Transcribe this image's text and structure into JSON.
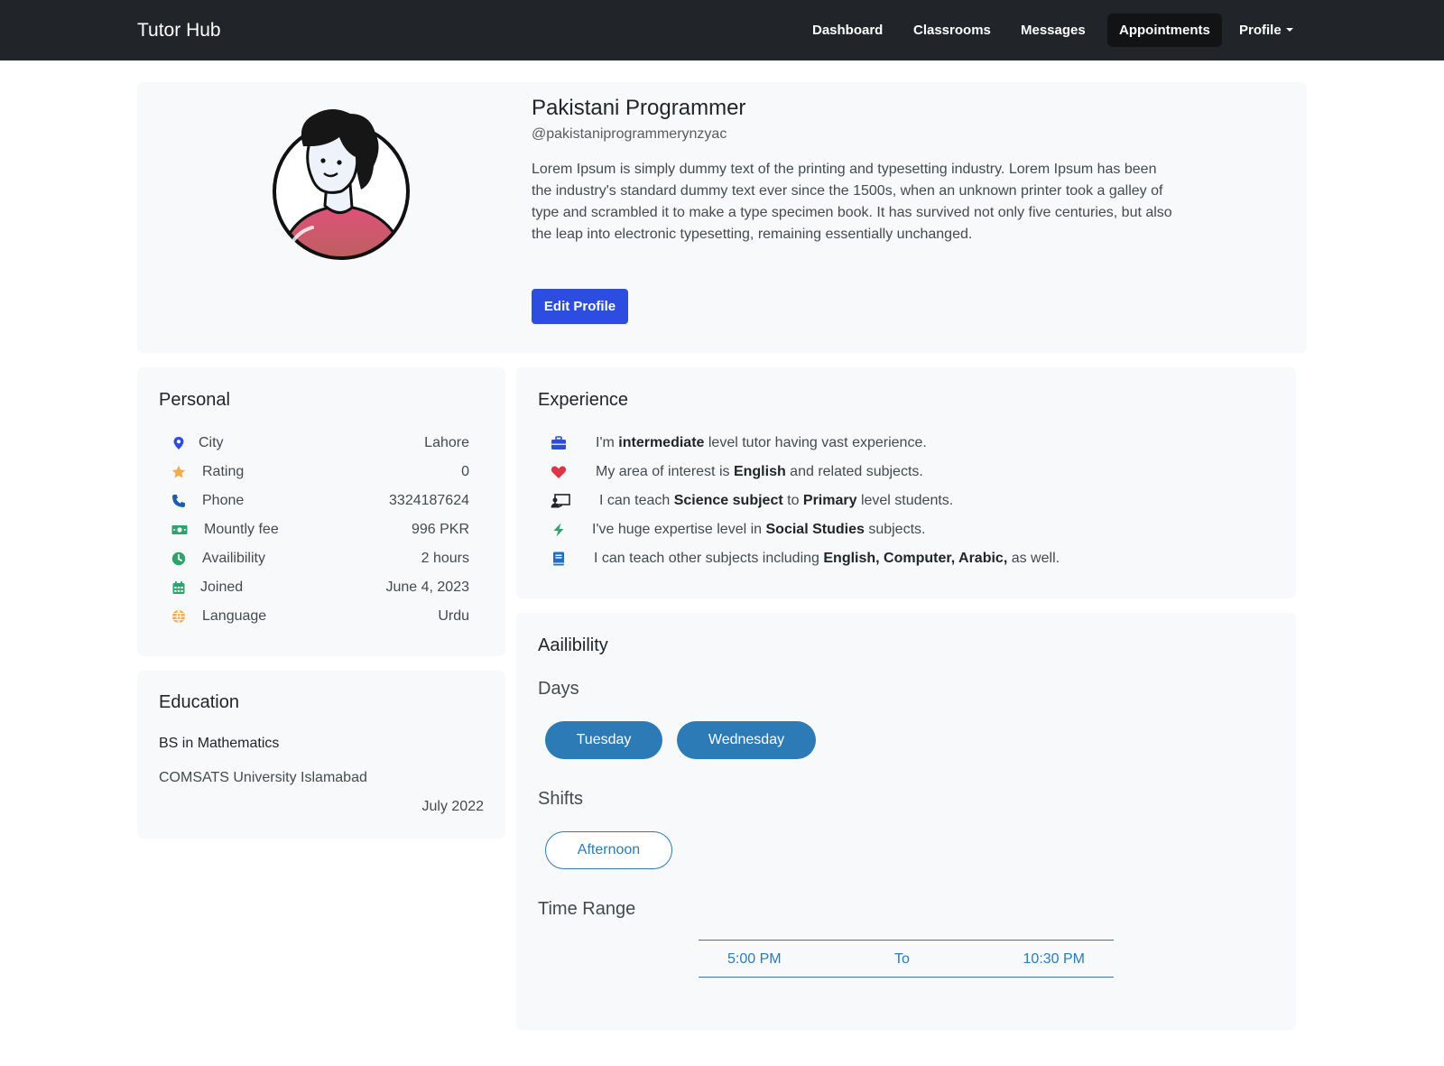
{
  "navbar": {
    "brand": "Tutor Hub",
    "items": [
      {
        "label": "Dashboard"
      },
      {
        "label": "Classrooms"
      },
      {
        "label": "Messages"
      },
      {
        "label": "Appointments",
        "active": true
      },
      {
        "label": "Profile",
        "dropdown": true
      }
    ]
  },
  "profile": {
    "name": "Pakistani Programmer",
    "handle": "@pakistaniprogrammerynzyac",
    "bio": "Lorem Ipsum is simply dummy text of the printing and typesetting industry. Lorem Ipsum has been the industry's standard dummy text ever since the 1500s, when an unknown printer took a galley of type and scrambled it to make a type specimen book. It has survived not only five centuries, but also the leap into electronic typesetting, remaining essentially unchanged.",
    "edit_button": "Edit Profile"
  },
  "personal": {
    "title": "Personal",
    "rows": [
      {
        "label": "City",
        "value": "Lahore",
        "icon": "map-pin-icon",
        "color": "#2d4de0"
      },
      {
        "label": "Rating",
        "value": "0",
        "icon": "star-icon",
        "color": "#f0ad4e"
      },
      {
        "label": "Phone",
        "value": "3324187624",
        "icon": "phone-icon",
        "color": "#1f5fa8"
      },
      {
        "label": "Mountly fee",
        "value": "996 PKR",
        "icon": "money-icon",
        "color": "#2ea36b"
      },
      {
        "label": "Availibility",
        "value": "2 hours",
        "icon": "clock-icon",
        "color": "#2ea36b"
      },
      {
        "label": "Joined",
        "value": "June 4, 2023",
        "icon": "calendar-icon",
        "color": "#2ea36b"
      },
      {
        "label": "Language",
        "value": "Urdu",
        "icon": "globe-icon",
        "color": "#f0ad4e"
      }
    ]
  },
  "education": {
    "title": "Education",
    "degree": "BS in Mathematics",
    "university": "COMSATS University Islamabad",
    "date": "July 2022"
  },
  "experience": {
    "title": "Experience",
    "items": [
      {
        "icon": "briefcase-icon",
        "color": "#2d4de0",
        "pre": "I'm ",
        "b1": "intermediate",
        "mid": " level tutor having vast experience.",
        "b2": "",
        "post": ""
      },
      {
        "icon": "heart-icon",
        "color": "#dc3545",
        "pre": "My area of interest is ",
        "b1": "English",
        "mid": " and related subjects.",
        "b2": "",
        "post": ""
      },
      {
        "icon": "teacher-board-icon",
        "color": "#212529",
        "pre": "I can teach ",
        "b1": "Science subject",
        "mid": " to ",
        "b2": "Primary",
        "post": " level students."
      },
      {
        "icon": "lightning-icon",
        "color": "#2ea36b",
        "pre": "I've huge expertise level in ",
        "b1": "Social Studies",
        "mid": " subjects.",
        "b2": "",
        "post": ""
      },
      {
        "icon": "book-icon",
        "color": "#1f6fc8",
        "pre": "I can teach other subjects including ",
        "b1": "English, Computer, Arabic,",
        "mid": " as well.",
        "b2": "",
        "post": ""
      }
    ]
  },
  "availability": {
    "title": "Aailibility",
    "days_label": "Days",
    "days": [
      "Tuesday",
      "Wednesday"
    ],
    "shifts_label": "Shifts",
    "shifts": [
      "Afternoon"
    ],
    "time_label": "Time Range",
    "time_from": "5:00 PM",
    "time_sep": "To",
    "time_to": "10:30 PM"
  },
  "colors": {
    "navbar": "#212529",
    "primary": "#2d4de0",
    "accent": "#2c7bb6",
    "card": "#f8f9fa"
  }
}
